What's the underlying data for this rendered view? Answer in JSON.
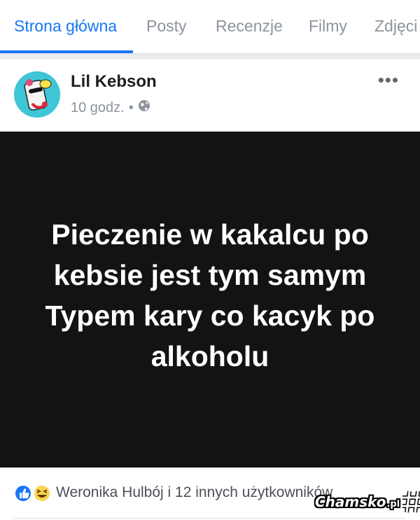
{
  "tabs": [
    {
      "label": "Strona główna",
      "active": true
    },
    {
      "label": "Posty"
    },
    {
      "label": "Recenzje"
    },
    {
      "label": "Filmy"
    },
    {
      "label": "Zdjęci"
    }
  ],
  "post": {
    "author": "Lil Kebson",
    "time": "10 godz.",
    "separator": "•",
    "audience_icon": "globe-icon",
    "more_label": "•••",
    "image_text": "Pieczenie w kakalcu po kebsie jest tym samym Typem kary co kacyk po alkoholu",
    "reactions_text": "Weronika Hulbój i 12 innych użytkowników",
    "reaction_icons": [
      "like-icon",
      "haha-icon"
    ]
  },
  "watermark": {
    "main": "Chamsko",
    "sub": ".pl"
  },
  "colors": {
    "accent": "#1877f2",
    "image_bg": "#131313",
    "muted": "#8d949e"
  }
}
